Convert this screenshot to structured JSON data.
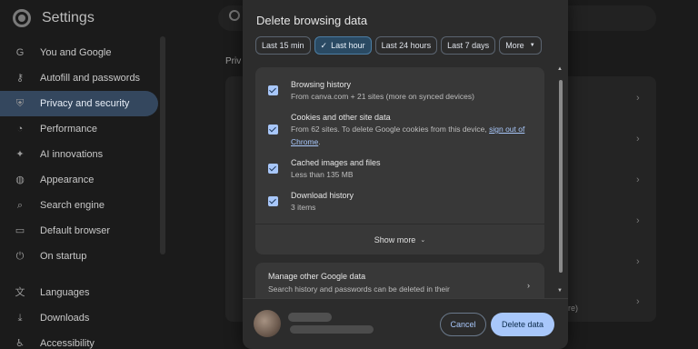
{
  "app": {
    "title": "Settings"
  },
  "sidebar": {
    "items": [
      {
        "label": "You and Google",
        "icon": "google-g-icon"
      },
      {
        "label": "Autofill and passwords",
        "icon": "key-icon"
      },
      {
        "label": "Privacy and security",
        "icon": "shield-icon",
        "active": true
      },
      {
        "label": "Performance",
        "icon": "speedometer-icon"
      },
      {
        "label": "AI innovations",
        "icon": "sparkle-icon"
      },
      {
        "label": "Appearance",
        "icon": "palette-icon"
      },
      {
        "label": "Search engine",
        "icon": "search-icon"
      },
      {
        "label": "Default browser",
        "icon": "browser-window-icon"
      },
      {
        "label": "On startup",
        "icon": "power-icon"
      },
      {
        "label": "Languages",
        "icon": "translate-icon"
      },
      {
        "label": "Downloads",
        "icon": "download-icon"
      },
      {
        "label": "Accessibility",
        "icon": "accessibility-icon"
      }
    ]
  },
  "background": {
    "section_label": "Priv",
    "fragment": "ore)"
  },
  "dialog": {
    "title": "Delete browsing data",
    "time_ranges": [
      {
        "label": "Last 15 min",
        "selected": false
      },
      {
        "label": "Last hour",
        "selected": true
      },
      {
        "label": "Last 24 hours",
        "selected": false
      },
      {
        "label": "Last 7 days",
        "selected": false
      },
      {
        "label": "More",
        "selected": false
      }
    ],
    "items": [
      {
        "title": "Browsing history",
        "subtitle": "From canva.com + 21 sites (more on synced devices)",
        "checked": true
      },
      {
        "title": "Cookies and other site data",
        "subtitle": "From 62 sites. To delete Google cookies from this device,",
        "link": "sign out of Chrome",
        "subtitle_end": ".",
        "checked": true
      },
      {
        "title": "Cached images and files",
        "subtitle": "Less than 135 MB",
        "checked": true
      },
      {
        "title": "Download history",
        "subtitle": "3 items",
        "checked": true
      }
    ],
    "show_more_label": "Show more",
    "manage": {
      "title": "Manage other Google data",
      "subtitle": "Search history and passwords can be deleted in their"
    },
    "cancel_label": "Cancel",
    "delete_label": "Delete data"
  },
  "colors": {
    "accent": "#a8c7fa",
    "dialog_bg": "#2c2c2c",
    "panel_bg": "#383838",
    "active_nav": "#34475e"
  }
}
